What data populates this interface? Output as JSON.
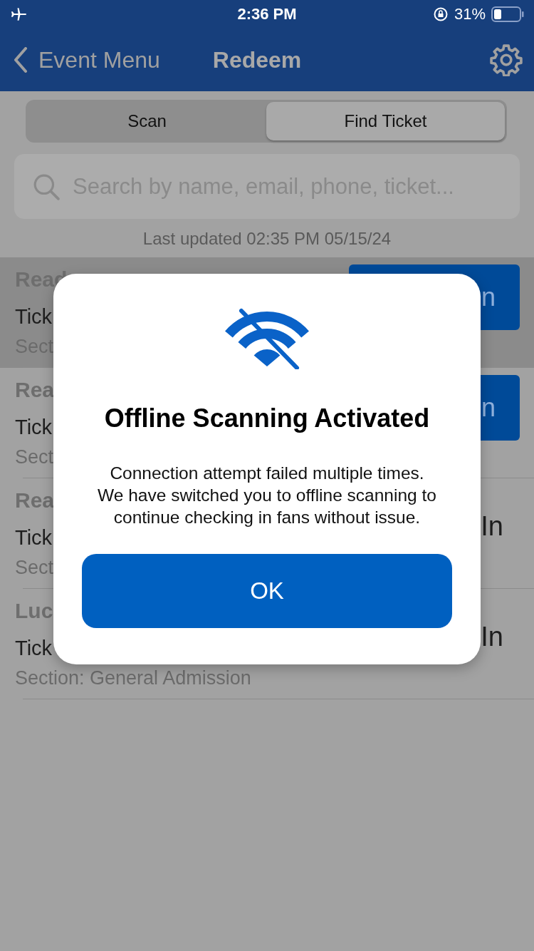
{
  "status_bar": {
    "time": "2:36 PM",
    "battery": "31%"
  },
  "nav": {
    "back_label": "Event Menu",
    "title": "Redeem"
  },
  "segments": [
    {
      "label": "Scan",
      "selected": false
    },
    {
      "label": "Find Ticket",
      "selected": true
    }
  ],
  "search": {
    "placeholder": "Search by name, email, phone, ticket..."
  },
  "last_updated": "Last updated 02:35 PM 05/15/24",
  "rows": [
    {
      "title": "Read",
      "ticket": "Tick",
      "section": "Sect",
      "action": "n",
      "kind": "button",
      "highlighted": true
    },
    {
      "title": "Rea",
      "ticket": "Tick",
      "section": "Sect",
      "action": "n",
      "kind": "button",
      "highlighted": false
    },
    {
      "title": "Rea",
      "ticket": "Tick",
      "section": "Sect",
      "action": "In",
      "kind": "text",
      "highlighted": false
    },
    {
      "title": "Luc",
      "ticket": "Tick",
      "section": "Section: General Admission",
      "action": "In",
      "kind": "text",
      "highlighted": false
    }
  ],
  "dialog": {
    "title": "Offline Scanning Activated",
    "message": "Connection attempt failed multiple times. We have switched you to offline scanning to continue checking in fans without issue.",
    "button": "OK"
  }
}
